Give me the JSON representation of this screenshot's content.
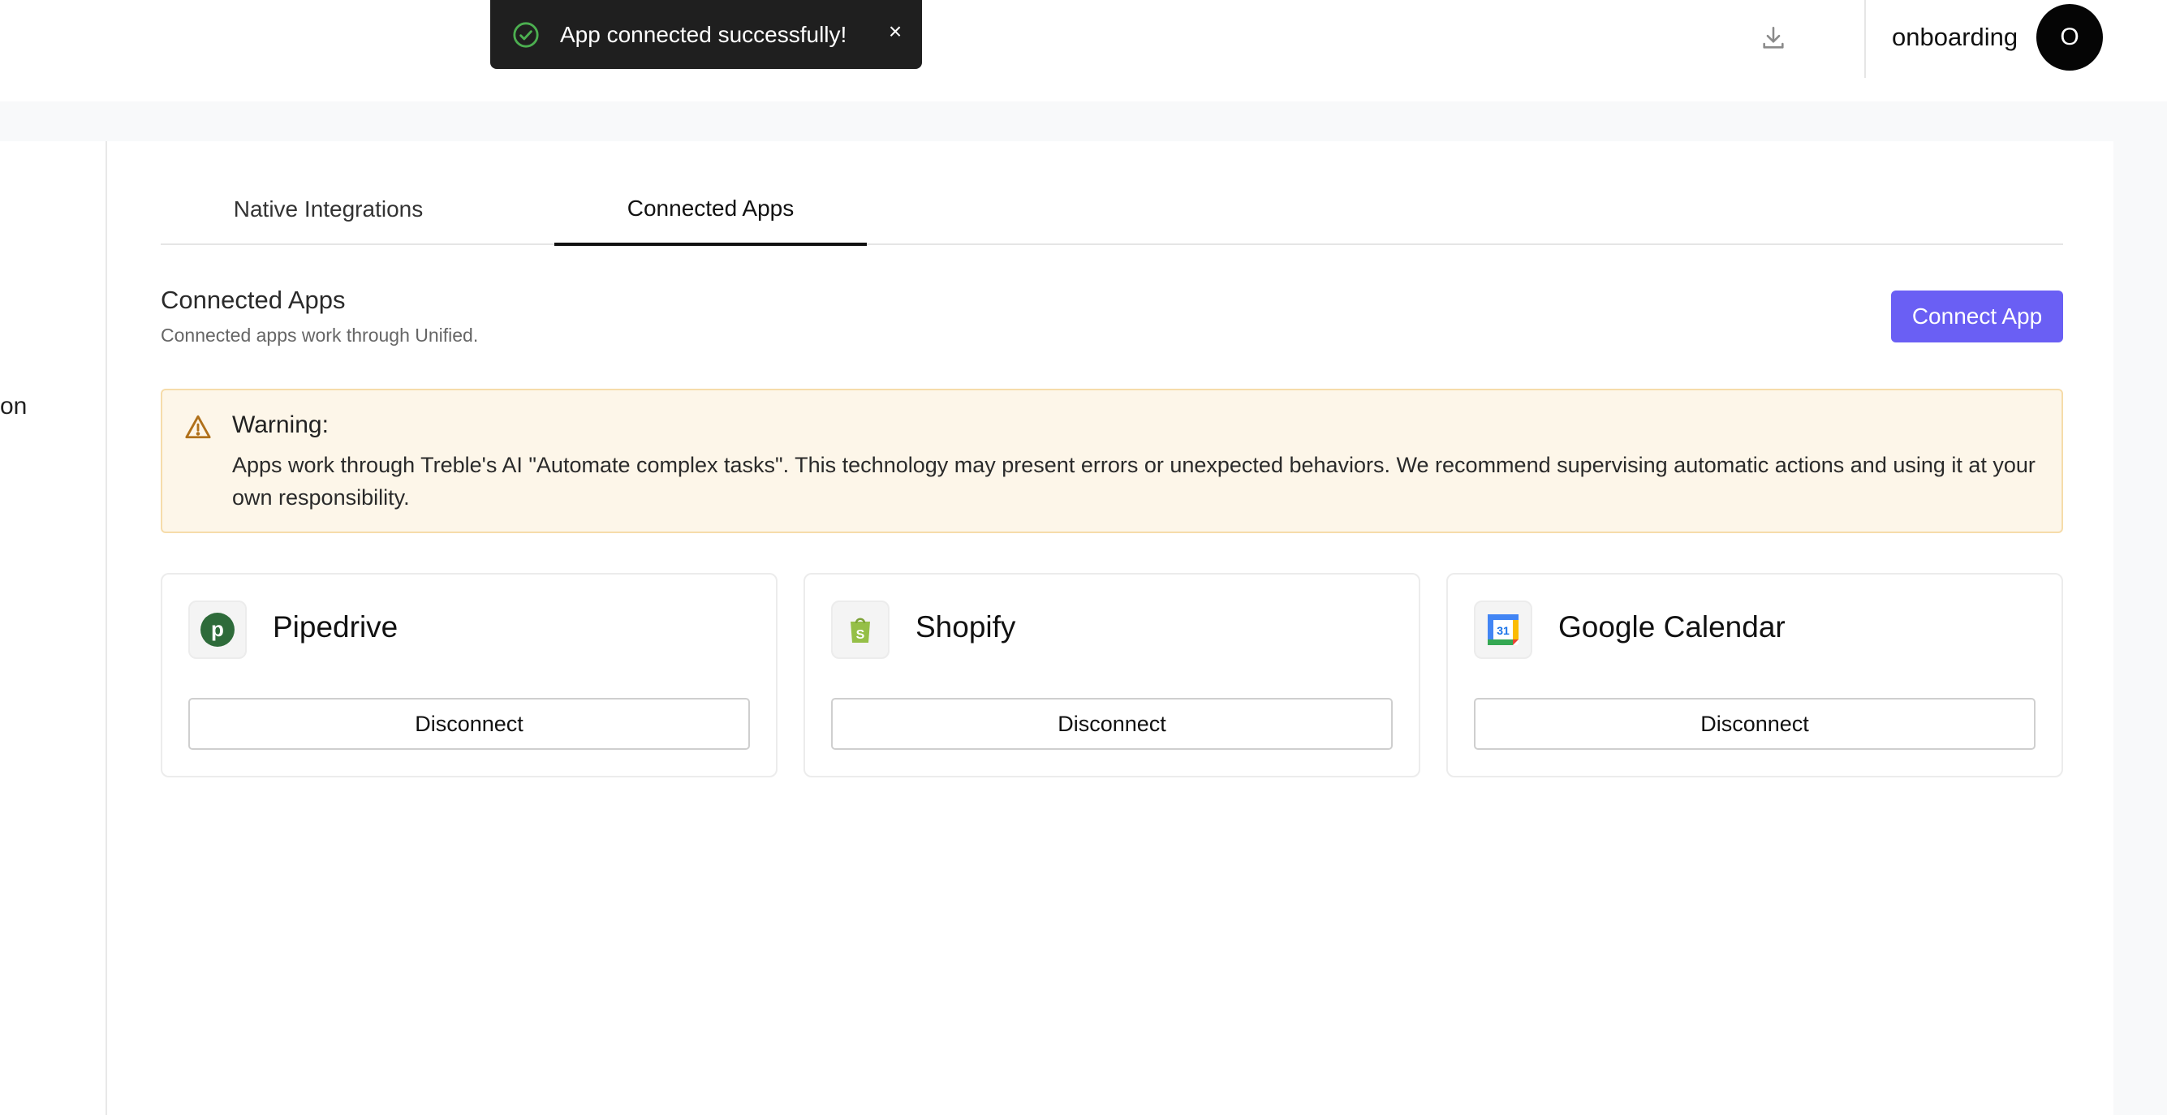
{
  "toast": {
    "message": "App connected successfully!",
    "close_label": "×",
    "icon": "check-circle-icon",
    "success_color": "#4caf50"
  },
  "header": {
    "download_icon": "download-icon",
    "user_name": "onboarding",
    "avatar_initial": "O"
  },
  "sidebar": {
    "visible_fragment": "on"
  },
  "tabs": [
    {
      "label": "Native Integrations",
      "active": false
    },
    {
      "label": "Connected Apps",
      "active": true
    }
  ],
  "section": {
    "title": "Connected Apps",
    "subtitle": "Connected apps work through Unified.",
    "connect_button": "Connect App"
  },
  "warning": {
    "title": "Warning:",
    "text": "Apps work through Treble's AI \"Automate complex tasks\". This technology may present errors or unexpected behaviors. We recommend supervising automatic actions and using it at your own responsibility.",
    "icon": "warning-triangle-icon"
  },
  "apps": [
    {
      "name": "Pipedrive",
      "icon": "pipedrive-icon",
      "action": "Disconnect"
    },
    {
      "name": "Shopify",
      "icon": "shopify-icon",
      "action": "Disconnect"
    },
    {
      "name": "Google Calendar",
      "icon": "google-calendar-icon",
      "action": "Disconnect",
      "icon_text": "31"
    }
  ],
  "colors": {
    "primary": "#6a5ff4",
    "toast_bg": "#1f1f1f",
    "warning_bg": "#fdf6e9",
    "warning_border": "#f6dcaa",
    "warning_icon": "#b0701a",
    "pipedrive": "#2e6b3a",
    "shopify": "#95bf47"
  }
}
